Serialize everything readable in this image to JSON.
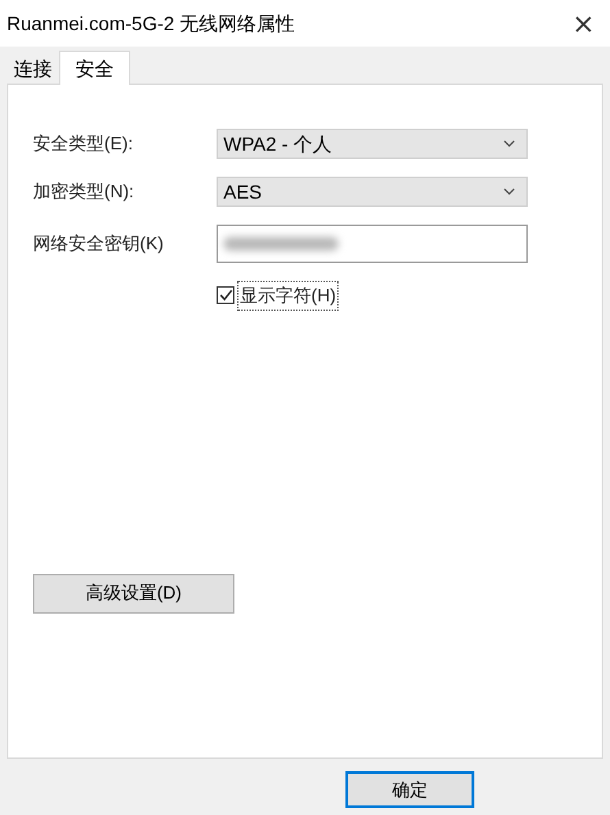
{
  "window": {
    "title": "Ruanmei.com-5G-2 无线网络属性",
    "close": "×"
  },
  "tabs": [
    {
      "label": "连接",
      "selected": false
    },
    {
      "label": "安全",
      "selected": true
    }
  ],
  "fields": [
    {
      "kind": "dropdown",
      "label": "安全类型(E):",
      "value": "WPA2 - 个人"
    },
    {
      "kind": "dropdown",
      "label": "加密类型(N):",
      "value": "AES"
    },
    {
      "kind": "redacted",
      "label": "网络安全密钥(K)"
    }
  ],
  "show_characters": {
    "label": "显示字符(H)",
    "checked": true
  },
  "advanced_button": "高级设置(D)",
  "buttons": [
    "确定"
  ]
}
